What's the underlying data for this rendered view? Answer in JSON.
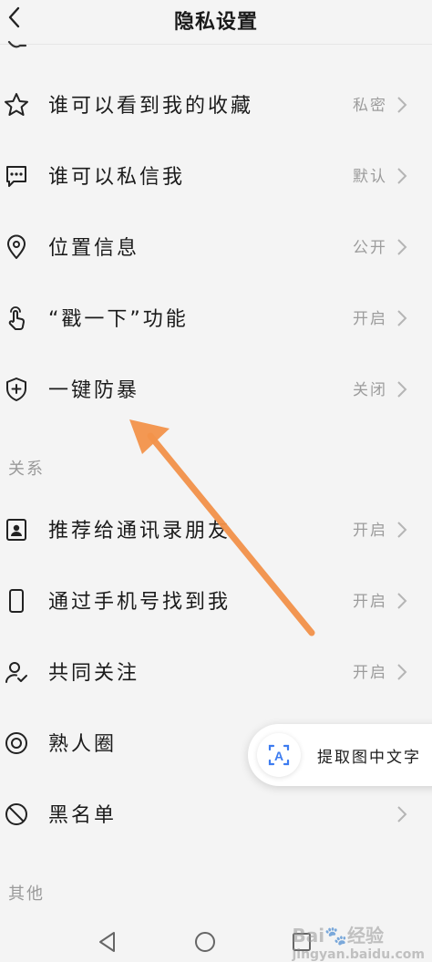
{
  "header": {
    "title": "隐私设置"
  },
  "privacy_items": [
    {
      "label": "谁可以看到我的收藏",
      "value": "私密",
      "icon": "star-icon"
    },
    {
      "label": "谁可以私信我",
      "value": "默认",
      "icon": "message-icon"
    },
    {
      "label": "位置信息",
      "value": "公开",
      "icon": "location-icon"
    },
    {
      "label": "“戳一下”功能",
      "value": "开启",
      "icon": "tap-hand-icon"
    },
    {
      "label": "一键防暴",
      "value": "关闭",
      "icon": "shield-plus-icon"
    }
  ],
  "relation_section": {
    "title": "关系"
  },
  "relation_items": [
    {
      "label": "推荐给通讯录朋友",
      "value": "开启",
      "icon": "contact-card-icon"
    },
    {
      "label": "通过手机号找到我",
      "value": "开启",
      "icon": "phone-icon"
    },
    {
      "label": "共同关注",
      "value": "开启",
      "icon": "user-check-icon"
    },
    {
      "label": "熟人圈",
      "value": "",
      "icon": "circle-target-icon"
    },
    {
      "label": "黑名单",
      "value": "",
      "icon": "block-icon"
    }
  ],
  "other_section": {
    "title": "其他"
  },
  "ocr_button": {
    "label": "提取图中文字",
    "icon_text": "A"
  },
  "watermark": {
    "brand": "Bai",
    "brand2": "经验",
    "sub": "jingyan.baidu.com"
  },
  "colors": {
    "annotation_arrow": "#f2924a",
    "value_gray": "#9c9c9c",
    "ocr_blue": "#3d7cf0"
  }
}
